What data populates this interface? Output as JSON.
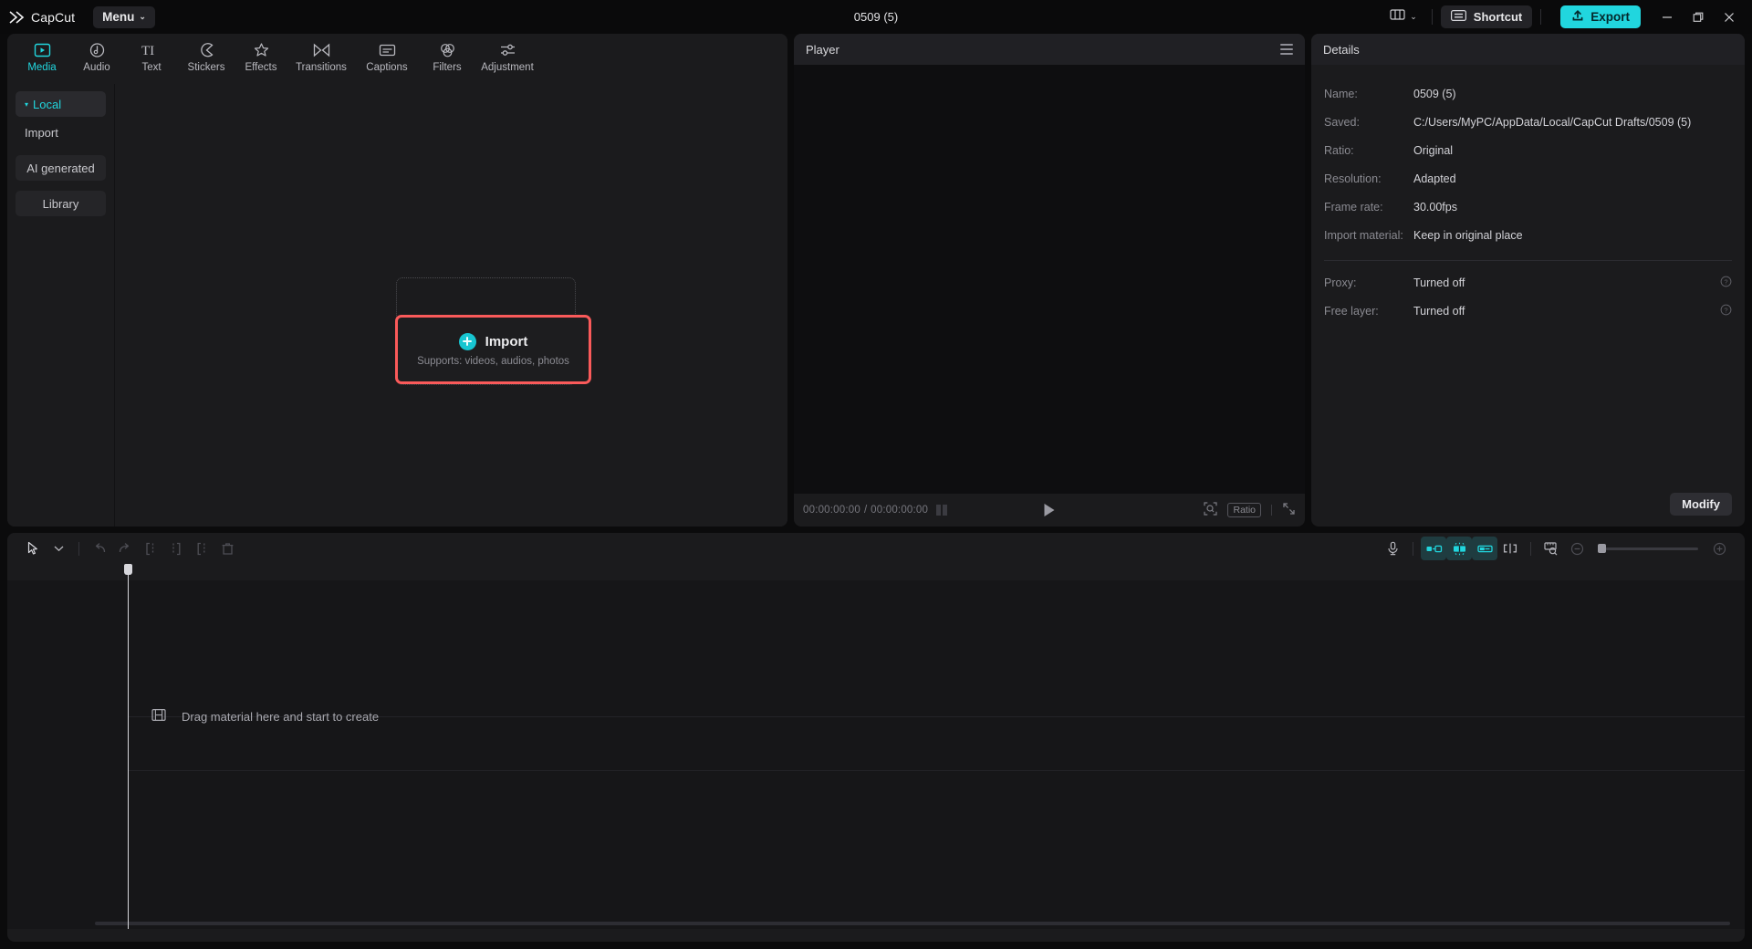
{
  "titlebar": {
    "brand": "CapCut",
    "menu_label": "Menu",
    "menu_caret": "⌄",
    "project_title": "0509 (5)",
    "layout_icon": "layout-icon",
    "layout_caret": "⌄",
    "shortcut_label": "Shortcut",
    "export_label": "Export",
    "minimize": "minimize-icon",
    "maximize": "maximize-icon",
    "close": "close-icon"
  },
  "media_tabs": [
    {
      "label": "Media",
      "icon": "media-icon",
      "active": true
    },
    {
      "label": "Audio",
      "icon": "audio-icon",
      "active": false
    },
    {
      "label": "Text",
      "icon": "text-icon",
      "active": false
    },
    {
      "label": "Stickers",
      "icon": "stickers-icon",
      "active": false
    },
    {
      "label": "Effects",
      "icon": "effects-icon",
      "active": false
    },
    {
      "label": "Transitions",
      "icon": "transitions-icon",
      "active": false
    },
    {
      "label": "Captions",
      "icon": "captions-icon",
      "active": false
    },
    {
      "label": "Filters",
      "icon": "filters-icon",
      "active": false
    },
    {
      "label": "Adjustment",
      "icon": "adjustment-icon",
      "active": false
    }
  ],
  "media_sidebar": [
    {
      "label": "Local",
      "selected": true,
      "chip": false,
      "caret": "▾"
    },
    {
      "label": "Import",
      "selected": false,
      "chip": false
    },
    {
      "label": "AI generated",
      "selected": false,
      "chip": true
    },
    {
      "label": "Library",
      "selected": false,
      "chip": true
    }
  ],
  "import": {
    "label": "Import",
    "sublabel": "Supports: videos, audios, photos",
    "highlight_color": "#fa5a5a",
    "plus_color": "#17c5d1"
  },
  "player": {
    "title": "Player",
    "current_time": "00:00:00:00",
    "total_time": "00:00:00:00",
    "time_separator": "/",
    "ratio_label": "Ratio",
    "play_icon": "play-icon",
    "fit_icon": "zoom-fit-icon",
    "fullscreen_icon": "fullscreen-icon",
    "menu_icon": "hamburger-icon"
  },
  "details": {
    "title": "Details",
    "rows": [
      {
        "label": "Name:",
        "value": "0509 (5)"
      },
      {
        "label": "Saved:",
        "value": "C:/Users/MyPC/AppData/Local/CapCut Drafts/0509 (5)"
      },
      {
        "label": "Ratio:",
        "value": "Original"
      },
      {
        "label": "Resolution:",
        "value": "Adapted"
      },
      {
        "label": "Frame rate:",
        "value": "30.00fps"
      },
      {
        "label": "Import material:",
        "value": "Keep in original place"
      }
    ],
    "toggle_rows": [
      {
        "label": "Proxy:",
        "value": "Turned off",
        "info": "?"
      },
      {
        "label": "Free layer:",
        "value": "Turned off",
        "info": "?"
      }
    ],
    "modify_label": "Modify"
  },
  "timeline": {
    "drag_hint": "Drag material here and start to create",
    "tools_left": [
      {
        "name": "select-tool-icon",
        "state": "normal"
      },
      {
        "name": "chevron-down-icon",
        "state": "normal"
      },
      {
        "name": "undo-icon",
        "state": "dim"
      },
      {
        "name": "redo-icon",
        "state": "dim"
      },
      {
        "name": "split-icon",
        "state": "dim"
      },
      {
        "name": "trim-left-icon",
        "state": "dim"
      },
      {
        "name": "trim-right-icon",
        "state": "dim"
      },
      {
        "name": "delete-icon",
        "state": "dim"
      }
    ],
    "tools_right": [
      {
        "name": "microphone-icon",
        "state": "normal"
      },
      {
        "name": "auto-snap-icon",
        "state": "active"
      },
      {
        "name": "magnet-snap-icon",
        "state": "active"
      },
      {
        "name": "link-clips-icon",
        "state": "active"
      },
      {
        "name": "keyframe-split-icon",
        "state": "normal"
      },
      {
        "name": "preview-ruler-icon",
        "state": "normal"
      },
      {
        "name": "zoom-out-icon",
        "state": "dim"
      },
      {
        "name": "zoom-in-icon",
        "state": "dim"
      }
    ],
    "zoom_value": 0
  },
  "colors": {
    "accent": "#21d6de",
    "highlight": "#fa5a5a",
    "panel_bg": "#1b1b1d",
    "app_bg": "#0b0b0c"
  }
}
